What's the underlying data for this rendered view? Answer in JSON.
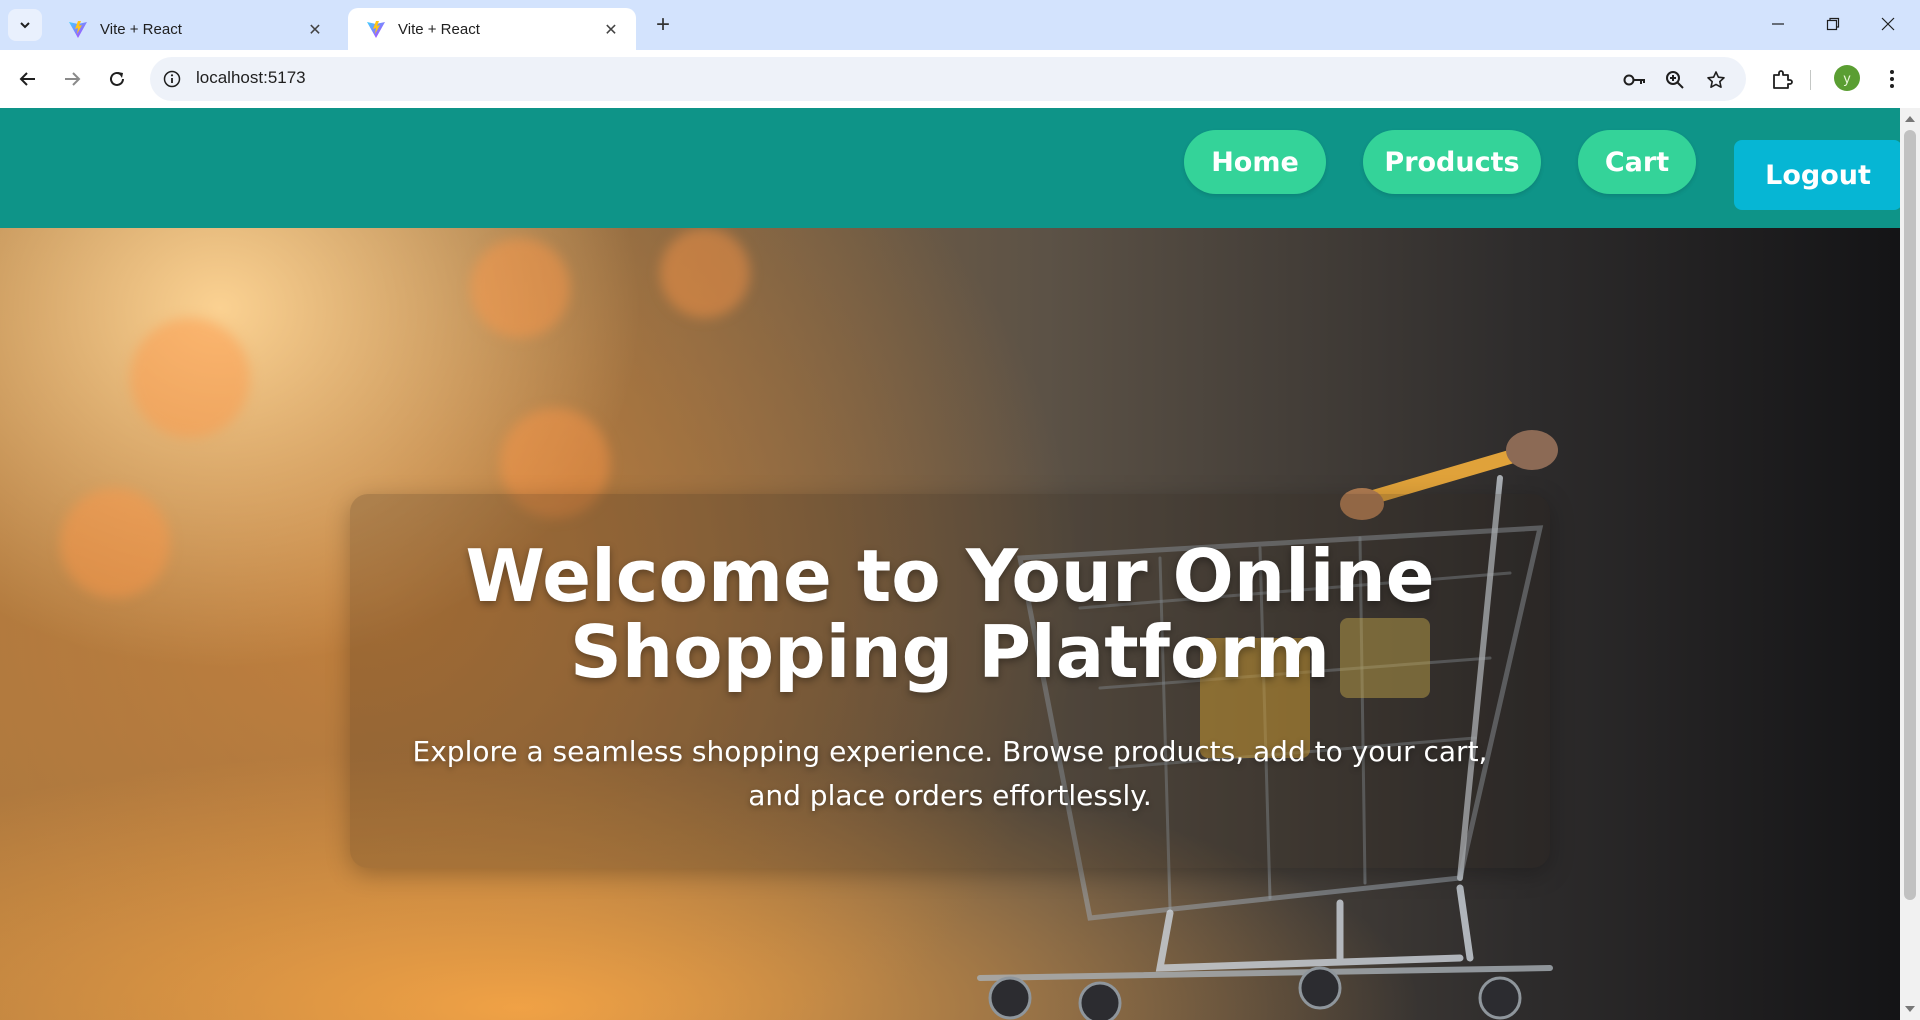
{
  "browser": {
    "tabs": [
      {
        "title": "Vite + React",
        "active": false,
        "favicon": "vite-icon",
        "close_glyph": "✕"
      },
      {
        "title": "Vite + React",
        "active": true,
        "favicon": "vite-icon",
        "close_glyph": "✕"
      }
    ],
    "new_tab_glyph": "+",
    "url": "localhost:5173",
    "profile_initial": "y",
    "icons": [
      "tab-search-icon",
      "back-icon",
      "forward-icon",
      "reload-icon",
      "site-info-icon",
      "password-key-icon",
      "zoom-icon",
      "bookmark-star-icon",
      "extensions-icon",
      "menu-icon",
      "minimize-icon",
      "restore-icon",
      "close-window-icon"
    ]
  },
  "nav": {
    "home": "Home",
    "products": "Products",
    "cart": "Cart",
    "logout": "Logout"
  },
  "hero": {
    "title": "Welcome to Your Online Shopping Platform",
    "subtitle": "Explore a seamless shopping experience. Browse products, add to your cart, and place orders effortlessly."
  },
  "colors": {
    "navbar": "#0e9488",
    "nav_pill": "#34d399",
    "logout": "#06b6d4",
    "tabstrip": "#d3e3fd"
  }
}
